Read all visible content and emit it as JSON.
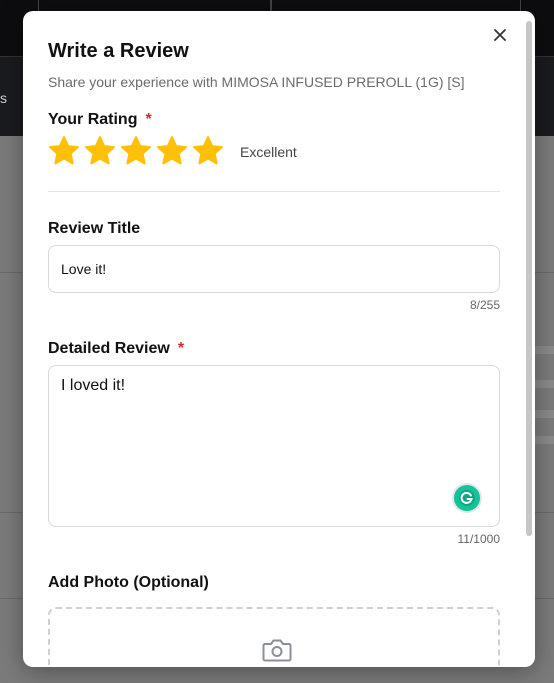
{
  "modal": {
    "title": "Write a Review",
    "subtitle": "Share your experience with MIMOSA INFUSED PREROLL (1G) [S]",
    "close_icon": "close-icon"
  },
  "rating": {
    "label": "Your Rating",
    "required_mark": "*",
    "value": 5,
    "max": 5,
    "text": "Excellent",
    "star_color": "#FFC107"
  },
  "review_title": {
    "label": "Review Title",
    "value": "Love it!",
    "counter": "8/255"
  },
  "detailed_review": {
    "label": "Detailed Review",
    "required_mark": "*",
    "value": "I loved it!",
    "counter": "11/1000",
    "assistant_icon": "grammarly-icon"
  },
  "photo": {
    "label": "Add Photo (Optional)",
    "icon": "camera-icon"
  },
  "background": {
    "nav_text": "s"
  },
  "colors": {
    "required": "#E02424",
    "grammarly": "#15C39A"
  }
}
